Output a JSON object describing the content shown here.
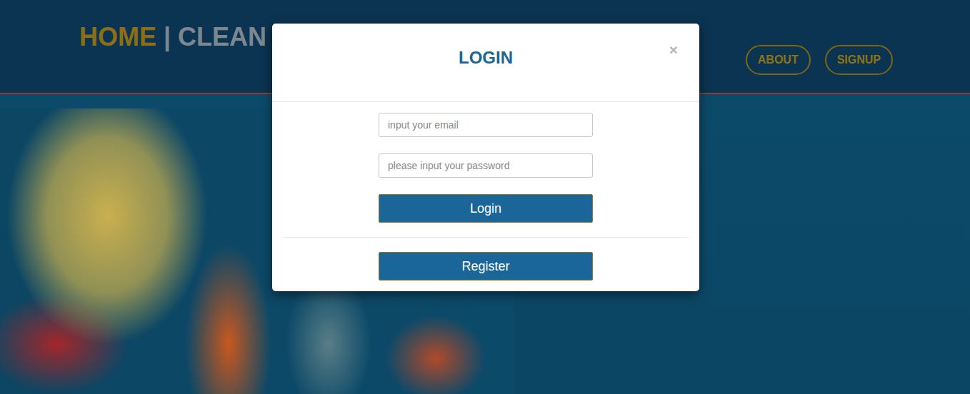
{
  "header": {
    "brand": {
      "home": "HOME",
      "separator": "|",
      "rest": "CLEAN"
    },
    "nav": [
      "ABOUT",
      "SIGNUP"
    ]
  },
  "modal": {
    "title": "LOGIN",
    "close": "×",
    "fields": [
      {
        "placeholder": "input your email",
        "type": "email"
      },
      {
        "placeholder": "please input your password",
        "type": "password"
      }
    ],
    "primary_button": "Login",
    "secondary_button": "Register"
  }
}
